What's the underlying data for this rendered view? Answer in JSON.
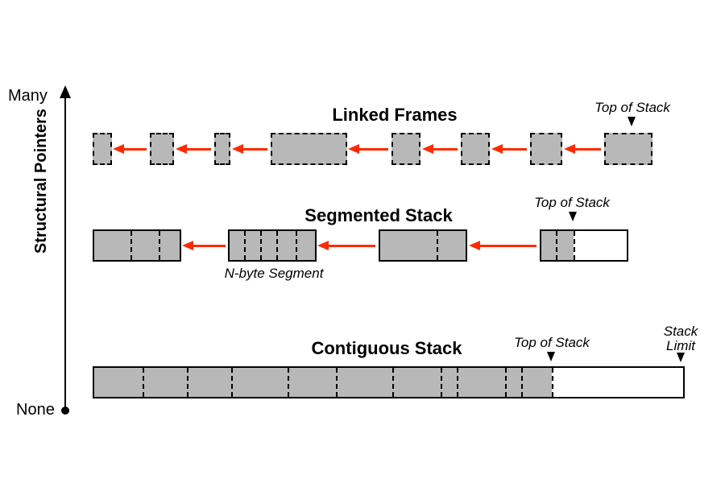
{
  "axis": {
    "title": "Structural Pointers",
    "top": "Many",
    "bottom": "None"
  },
  "sections": {
    "linked": {
      "title": "Linked Frames",
      "top_annot": "Top of Stack"
    },
    "segmented": {
      "title": "Segmented Stack",
      "top_annot": "Top of Stack",
      "segment_caption": "N-byte Segment"
    },
    "contig": {
      "title": "Contiguous Stack",
      "top_annot": "Top of Stack",
      "limit_annot": "Stack\nLimit"
    }
  },
  "colors": {
    "fill": "#b8b8b8",
    "arrow": "#ff2a00"
  }
}
